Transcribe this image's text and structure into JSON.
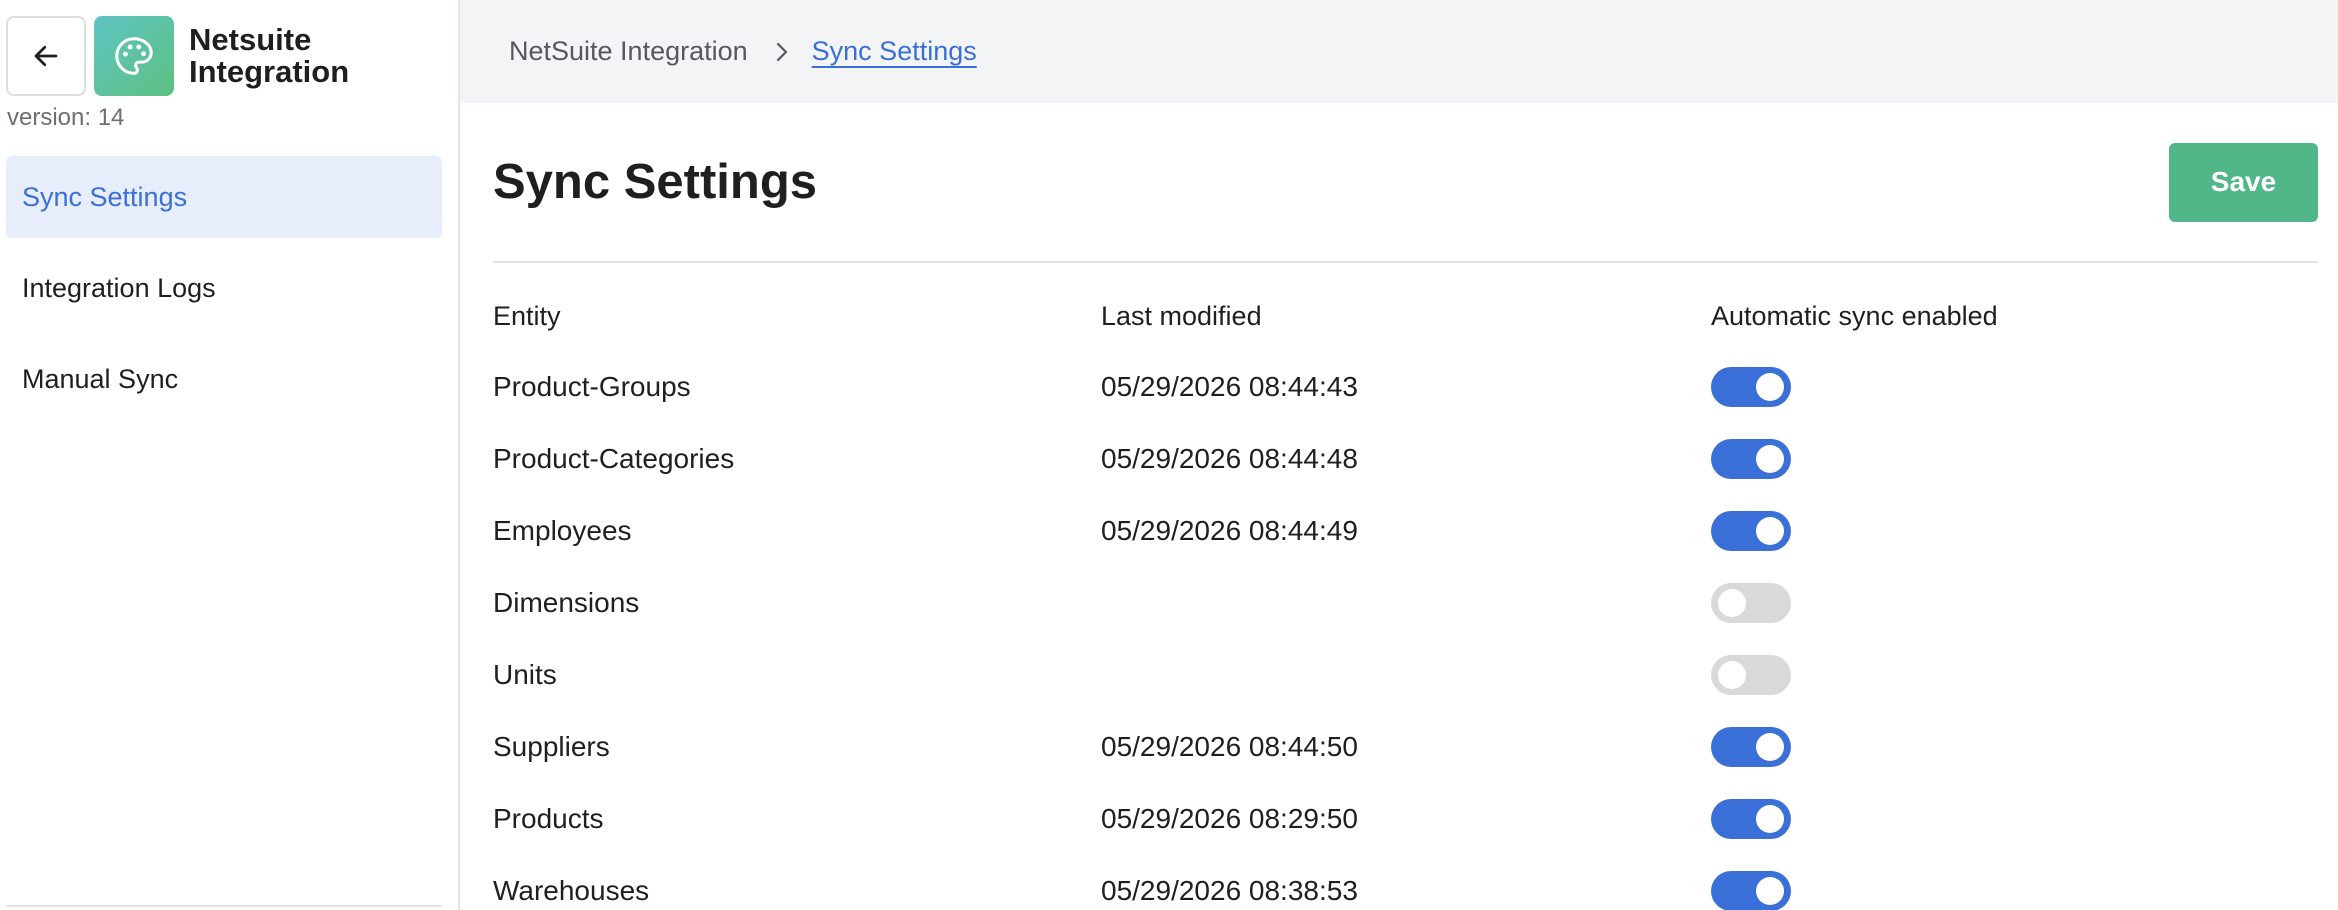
{
  "app": {
    "name_line1": "Netsuite",
    "name_line2": "Integration",
    "version": "version: 14"
  },
  "sidebar": {
    "items": [
      {
        "label": "Sync Settings",
        "active": true
      },
      {
        "label": "Integration Logs",
        "active": false
      },
      {
        "label": "Manual Sync",
        "active": false
      }
    ]
  },
  "breadcrumb": {
    "parent": "NetSuite Integration",
    "current": "Sync Settings"
  },
  "page": {
    "title": "Sync Settings",
    "save_label": "Save"
  },
  "table": {
    "headers": {
      "entity": "Entity",
      "last_modified": "Last modified",
      "auto_sync": "Automatic sync enabled"
    },
    "rows": [
      {
        "entity": "Product-Groups",
        "last_modified": "05/29/2026 08:44:43",
        "enabled": true
      },
      {
        "entity": "Product-Categories",
        "last_modified": "05/29/2026 08:44:48",
        "enabled": true
      },
      {
        "entity": "Employees",
        "last_modified": "05/29/2026 08:44:49",
        "enabled": true
      },
      {
        "entity": "Dimensions",
        "last_modified": "",
        "enabled": false
      },
      {
        "entity": "Units",
        "last_modified": "",
        "enabled": false
      },
      {
        "entity": "Suppliers",
        "last_modified": "05/29/2026 08:44:50",
        "enabled": true
      },
      {
        "entity": "Products",
        "last_modified": "05/29/2026 08:29:50",
        "enabled": true
      },
      {
        "entity": "Warehouses",
        "last_modified": "05/29/2026 08:38:53",
        "enabled": true
      }
    ]
  },
  "colors": {
    "accent": "#3b6fd8",
    "save_button": "#52b788",
    "active_nav_bg": "#e8edfb",
    "toggle_off": "#d9d9d9"
  },
  "icons": {
    "back": "arrow-left-icon",
    "app": "palette-icon",
    "breadcrumb_separator": "chevron-right-icon"
  }
}
